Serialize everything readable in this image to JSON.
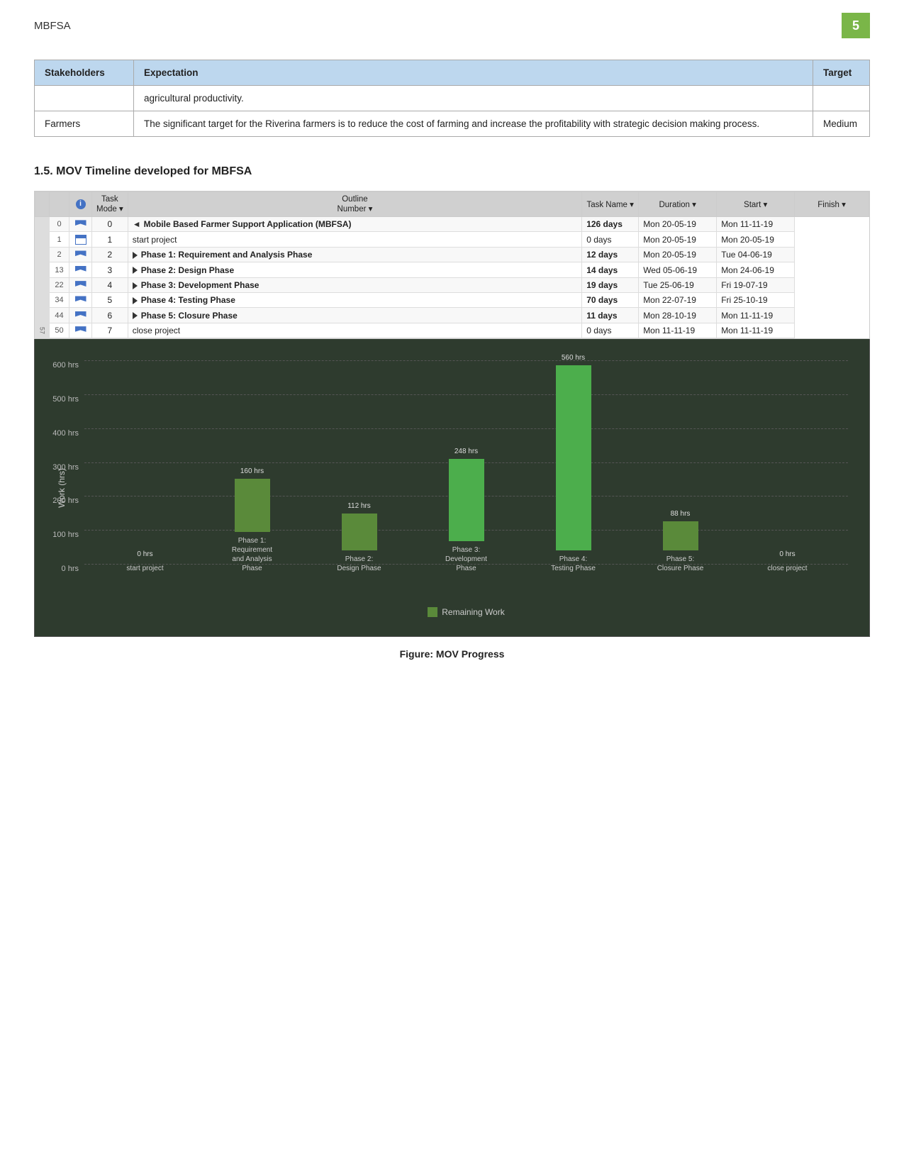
{
  "header": {
    "title": "MBFSA",
    "page_number": "5"
  },
  "table": {
    "columns": [
      "Stakeholders",
      "Expectation",
      "Target"
    ],
    "rows": [
      {
        "stakeholder": "",
        "expectation": "agricultural productivity.",
        "target": ""
      },
      {
        "stakeholder": "Farmers",
        "expectation": "The significant target for the Riverina farmers is to reduce the cost of farming and increase the profitability with strategic decision making process.",
        "target": "Medium"
      }
    ]
  },
  "section": {
    "heading": "1.5. MOV Timeline developed for MBFSA"
  },
  "gantt": {
    "columns": {
      "task_mode": "Task Mode",
      "outline_number": "Outline Number",
      "task_name": "Task Name",
      "duration": "Duration",
      "start": "Start",
      "finish": "Finish"
    },
    "rows": [
      {
        "id": "",
        "row_num": "0",
        "task_mode": "flag",
        "outline": "0",
        "task_name": "Mobile Based Farmer Support Application (MBFSA)",
        "bold": true,
        "duration": "126 days",
        "start": "Mon 20-05-19",
        "finish": "Mon 11-11-19",
        "triangle": false,
        "is_parent": true
      },
      {
        "id": "1",
        "row_num": "1",
        "task_mode": "cal",
        "outline": "1",
        "task_name": "start project",
        "bold": false,
        "duration": "0 days",
        "start": "Mon 20-05-19",
        "finish": "Mon 20-05-19",
        "triangle": false,
        "is_parent": false
      },
      {
        "id": "2",
        "row_num": "2",
        "task_mode": "flag",
        "outline": "2",
        "task_name": "Phase 1: Requirement and Analysis Phase",
        "bold": true,
        "duration": "12 days",
        "start": "Mon 20-05-19",
        "finish": "Tue 04-06-19",
        "triangle": true,
        "is_parent": false
      },
      {
        "id": "13",
        "row_num": "13",
        "task_mode": "flag",
        "outline": "3",
        "task_name": "Phase 2: Design Phase",
        "bold": true,
        "duration": "14 days",
        "start": "Wed 05-06-19",
        "finish": "Mon 24-06-19",
        "triangle": true,
        "is_parent": false
      },
      {
        "id": "22",
        "row_num": "22",
        "task_mode": "flag",
        "outline": "4",
        "task_name": "Phase 3: Development Phase",
        "bold": true,
        "duration": "19 days",
        "start": "Tue 25-06-19",
        "finish": "Fri 19-07-19",
        "triangle": true,
        "is_parent": false
      },
      {
        "id": "34",
        "row_num": "34",
        "task_mode": "flag",
        "outline": "5",
        "task_name": "Phase 4: Testing Phase",
        "bold": true,
        "duration": "70 days",
        "start": "Mon 22-07-19",
        "finish": "Fri 25-10-19",
        "triangle": true,
        "is_parent": false
      },
      {
        "id": "44",
        "row_num": "44",
        "task_mode": "flag",
        "outline": "6",
        "task_name": "Phase 5: Closure Phase",
        "bold": true,
        "duration": "11 days",
        "start": "Mon 28-10-19",
        "finish": "Mon 11-11-19",
        "triangle": true,
        "is_parent": false
      },
      {
        "id": "50",
        "row_num": "50",
        "task_mode": "flag",
        "outline": "7",
        "task_name": "close project",
        "bold": false,
        "duration": "0 days",
        "start": "Mon 11-11-19",
        "finish": "Mon 11-11-19",
        "triangle": false,
        "is_parent": false
      }
    ]
  },
  "chart": {
    "y_label": "Work (hrs)",
    "y_ticks": [
      "600 hrs",
      "500 hrs",
      "400 hrs",
      "300 hrs",
      "200 hrs",
      "100 hrs",
      "0 hrs"
    ],
    "bars": [
      {
        "label": "start project",
        "x_label": "start project",
        "value": 0,
        "height_pct": 0,
        "display": "0 hrs",
        "is_bright": false
      },
      {
        "label": "Phase 1:\nRequirement\nand Analysis\nPhase",
        "x_label": "Phase 1:\nRequirement\nand Analysis\nPhase",
        "value": 160,
        "height_pct": 26.7,
        "display": "160 hrs",
        "is_bright": false
      },
      {
        "label": "Phase 2:\nDesign Phase",
        "x_label": "Phase 2:\nDesign Phase",
        "value": 112,
        "height_pct": 18.7,
        "display": "112 hrs",
        "is_bright": false
      },
      {
        "label": "Phase 3:\nDevelopment\nPhase",
        "x_label": "Phase 3:\nDevelopment\nPhase",
        "value": 248,
        "height_pct": 41.3,
        "display": "248 hrs",
        "is_bright": true
      },
      {
        "label": "Phase 4:\nTesting Phase",
        "x_label": "Phase 4:\nTesting Phase",
        "value": 560,
        "height_pct": 93.3,
        "display": "560 hrs",
        "is_bright": true
      },
      {
        "label": "Phase 5:\nClosure Phase",
        "x_label": "Phase 5:\nClosure Phase",
        "value": 88,
        "height_pct": 14.7,
        "display": "88 hrs",
        "is_bright": false
      },
      {
        "label": "close project",
        "x_label": "close project",
        "value": 0,
        "height_pct": 0,
        "display": "0 hrs",
        "is_bright": false
      }
    ],
    "legend": "Remaining Work"
  },
  "figure_caption": "Figure: MOV Progress"
}
